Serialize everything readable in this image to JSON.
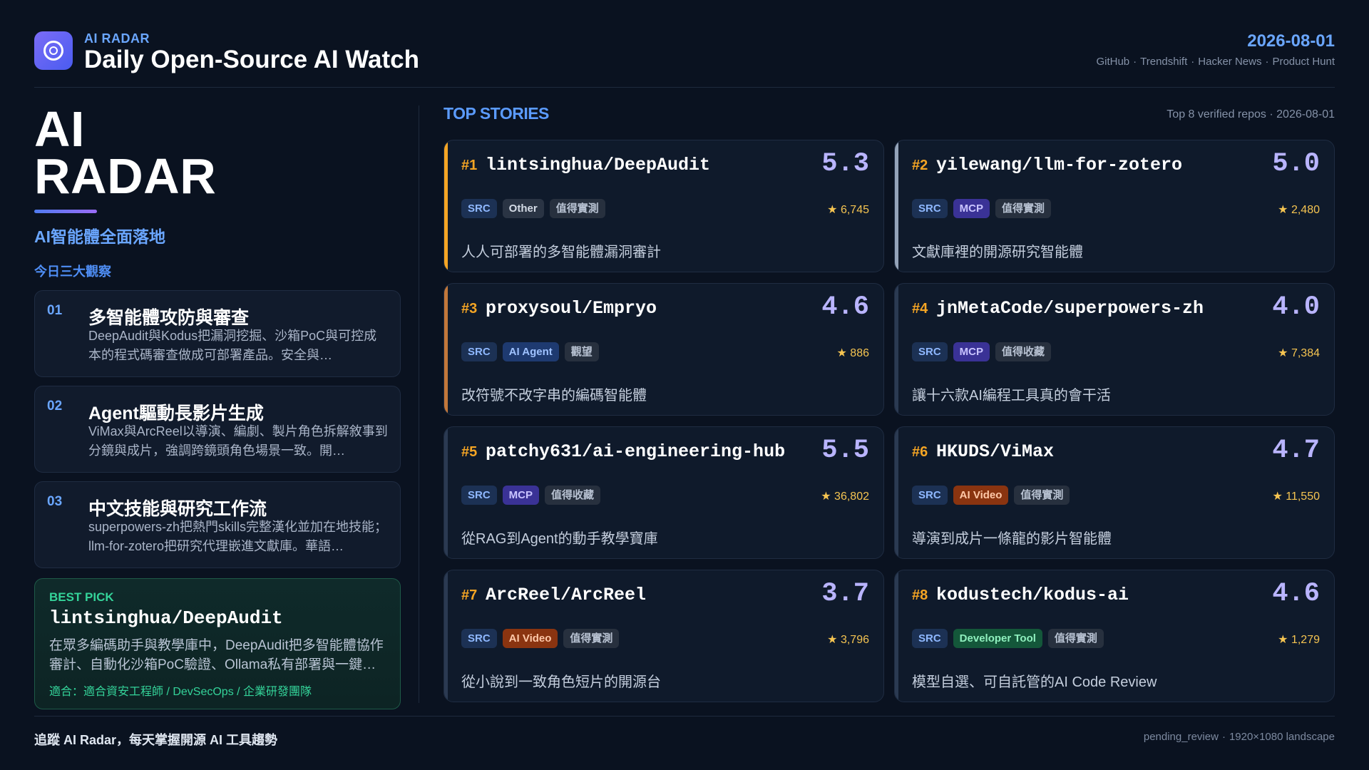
{
  "header": {
    "brand_small": "AI RADAR",
    "title": "Daily Open-Source AI Watch",
    "date": "2026-08-01",
    "sources": [
      "GitHub",
      "Trendshift",
      "Hacker News",
      "Product Hunt"
    ],
    "logo_icon": "radar-ring-icon"
  },
  "left": {
    "big_title_line1": "AI",
    "big_title_line2": "RADAR",
    "tagline": "AI智能體全面落地",
    "insights_label": "今日三大觀察",
    "insights": [
      {
        "num": "01",
        "title": "多智能體攻防與審查",
        "desc": "DeepAudit與Kodus把漏洞挖掘、沙箱PoC與可控成本的程式碼審查做成可部署產品。安全與…"
      },
      {
        "num": "02",
        "title": "Agent驅動長影片生成",
        "desc": "ViMax與ArcReel以導演、編劇、製片角色拆解敘事到分鏡與成片，強調跨鏡頭角色場景一致。開…"
      },
      {
        "num": "03",
        "title": "中文技能與研究工作流",
        "desc": "superpowers-zh把熱門skills完整漢化並加在地技能；llm-for-zotero把研究代理嵌進文獻庫。華語…"
      }
    ],
    "best_pick": {
      "label": "BEST PICK",
      "repo": "lintsinghua/DeepAudit",
      "desc": "在眾多編碼助手與教學庫中，DeepAudit把多智能體協作審計、自動化沙箱PoC驗證、Ollama私有部署與一鍵…",
      "fit": "適合：適合資安工程師 / DevSecOps / 企業研發團隊"
    }
  },
  "stories": {
    "title": "TOP STORIES",
    "subtitle": "Top 8 verified repos · 2026-08-01",
    "items": [
      {
        "rank": "#1",
        "repo": "lintsinghua/DeepAudit",
        "score": "5.3",
        "src": "SRC",
        "category": "Other",
        "verdict": "值得實測",
        "stars": "★ 6,745",
        "desc": "人人可部署的多智能體漏洞審計",
        "accent": "#f5a524"
      },
      {
        "rank": "#2",
        "repo": "yilewang/llm-for-zotero",
        "score": "5.0",
        "src": "SRC",
        "category": "MCP",
        "verdict": "值得實測",
        "stars": "★ 2,480",
        "desc": "文獻庫裡的開源研究智能體",
        "accent": "#94a3b8"
      },
      {
        "rank": "#3",
        "repo": "proxysoul/Empryo",
        "score": "4.6",
        "src": "SRC",
        "category": "AI Agent",
        "verdict": "觀望",
        "stars": "★ 886",
        "desc": "改符號不改字串的編碼智能體",
        "accent": "#c2773a"
      },
      {
        "rank": "#4",
        "repo": "jnMetaCode/superpowers-zh",
        "score": "4.0",
        "src": "SRC",
        "category": "MCP",
        "verdict": "值得收藏",
        "stars": "★ 7,384",
        "desc": "讓十六款AI編程工具真的會干活",
        "accent": "#2b3a52"
      },
      {
        "rank": "#5",
        "repo": "patchy631/ai-engineering-hub",
        "score": "5.5",
        "src": "SRC",
        "category": "MCP",
        "verdict": "值得收藏",
        "stars": "★ 36,802",
        "desc": "從RAG到Agent的動手教學寶庫",
        "accent": "#2b3a52"
      },
      {
        "rank": "#6",
        "repo": "HKUDS/ViMax",
        "score": "4.7",
        "src": "SRC",
        "category": "AI Video",
        "verdict": "值得實測",
        "stars": "★ 11,550",
        "desc": "導演到成片一條龍的影片智能體",
        "accent": "#2b3a52"
      },
      {
        "rank": "#7",
        "repo": "ArcReel/ArcReel",
        "score": "3.7",
        "src": "SRC",
        "category": "AI Video",
        "verdict": "值得實測",
        "stars": "★ 3,796",
        "desc": "從小說到一致角色短片的開源台",
        "accent": "#2b3a52"
      },
      {
        "rank": "#8",
        "repo": "kodustech/kodus-ai",
        "score": "4.6",
        "src": "SRC",
        "category": "Developer Tool",
        "verdict": "值得實測",
        "stars": "★ 1,279",
        "desc": "模型自選、可自託管的AI Code Review",
        "accent": "#2b3a52"
      }
    ]
  },
  "footer": {
    "left": "追蹤 AI Radar，每天掌握開源 AI 工具趨勢",
    "right_status": "pending_review",
    "right_size": "1920×1080 landscape"
  },
  "colors": {
    "background": "#0a1220",
    "accent_blue": "#6aa6ff",
    "accent_green": "#34d399",
    "rank_orange": "#f5a524",
    "score_lavender": "#b9b4ff"
  }
}
